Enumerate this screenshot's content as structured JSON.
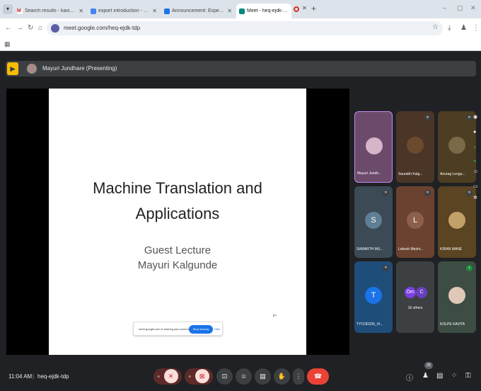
{
  "browser": {
    "tabs": [
      {
        "title": "Search results - kavita.kolpe@v",
        "fav_color": "#c5221f",
        "fav": "M"
      },
      {
        "title": "export introduction - Google D",
        "fav_color": "#4285f4",
        "fav": ""
      },
      {
        "title": "Announcement: Expert session",
        "fav_color": "#1a73e8",
        "fav": ""
      },
      {
        "title": "Meet - heq-ejdk-tdp",
        "fav_color": "#00897b",
        "fav": ""
      }
    ],
    "new_tab": "+",
    "win_min": "–",
    "win_max": "▢",
    "win_close": "✕",
    "url": "meet.google.com/heq-ejdk-tdp"
  },
  "meet": {
    "presenter_label": "Mayuri Jundhare (Presenting)",
    "slide": {
      "title_line1": "Machine Translation and",
      "title_line2": "Applications",
      "subtitle_line1": "Guest Lecture",
      "subtitle_line2": "Mayuri Kalgunde"
    },
    "share_bar": {
      "text": "meet.google.com is sharing your screen.",
      "stop": "Stop sharing",
      "hide": "Hide"
    },
    "tiles": [
      {
        "name": "Mayuri Jundh...",
        "bg": "#6b4a6b",
        "avatar": "#d8b4c8"
      },
      {
        "name": "Saurabh Kalg...",
        "bg": "#4a3527",
        "avatar": "#6b4a2e"
      },
      {
        "name": "Anurag Lengu...",
        "bg": "#4d3d22",
        "avatar": "#7a6a48"
      },
      {
        "name": "SAMARTH MU...",
        "bg": "#3b4a55",
        "letter": "S",
        "letter_bg": "#5e7f94"
      },
      {
        "name": "Lokesh Meshr...",
        "bg": "#6b4230",
        "letter": "L",
        "letter_bg": "#8d5f4a"
      },
      {
        "name": "KIRAN MANE",
        "bg": "#5a4422",
        "avatar": "#c1a06a"
      },
      {
        "name": "TYCOD230_VI...",
        "bg": "#1f4d7a",
        "letter": "T",
        "letter_bg": "#1a73e8"
      },
      {
        "others_label": "16 others",
        "bubble1": "Om",
        "bubble2": "C",
        "bg": "#3c4043"
      },
      {
        "name": "KOLPE KAVITA",
        "bg": "#3d4d43",
        "avatar": "#e0c8b8"
      }
    ],
    "time": "11:04 AM",
    "separator": "|",
    "meeting_code": "heq-ejdk-tdp",
    "participants_count": "25"
  }
}
